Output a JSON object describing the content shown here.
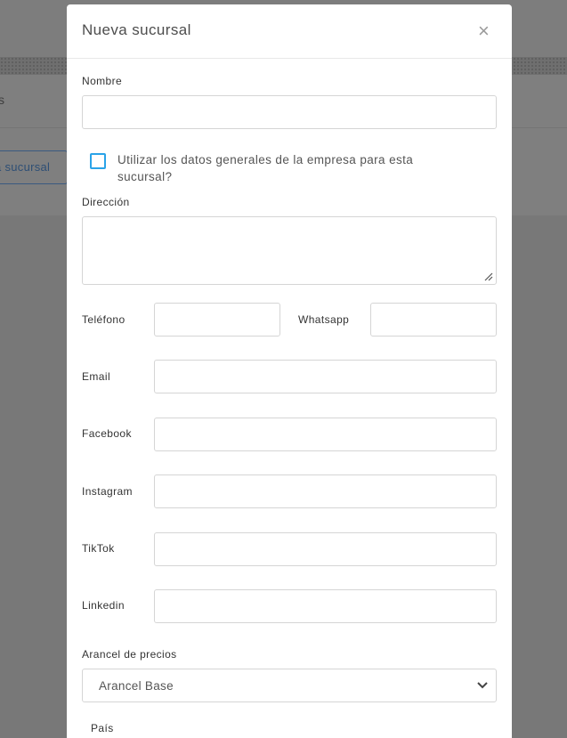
{
  "background": {
    "crumb_tail": "s",
    "add_branch_button_label": "a sucursal"
  },
  "modal": {
    "title": "Nueva sucursal",
    "close_symbol": "×"
  },
  "form": {
    "nombre": {
      "label": "Nombre",
      "value": ""
    },
    "use_company_data": {
      "label": "Utilizar los datos generales de la empresa para esta sucursal?",
      "checked": false
    },
    "direccion": {
      "label": "Dirección",
      "value": ""
    },
    "telefono": {
      "label": "Teléfono",
      "value": ""
    },
    "whatsapp": {
      "label": "Whatsapp",
      "value": ""
    },
    "email": {
      "label": "Email",
      "value": ""
    },
    "facebook": {
      "label": "Facebook",
      "value": ""
    },
    "instagram": {
      "label": "Instagram",
      "value": ""
    },
    "tiktok": {
      "label": "TikTok",
      "value": ""
    },
    "linkedin": {
      "label": "Linkedin",
      "value": ""
    },
    "arancel": {
      "label": "Arancel de precios",
      "selected": "Arancel Base"
    },
    "pais": {
      "label": "País"
    }
  },
  "colors": {
    "checkbox_accent": "#2aa3e8",
    "overlay": "#7a7a7a",
    "background_button": "#2e4f75"
  },
  "icons": {
    "close": "close-icon",
    "chevron": "chevron-down-icon",
    "resize": "resize-grip-icon"
  }
}
